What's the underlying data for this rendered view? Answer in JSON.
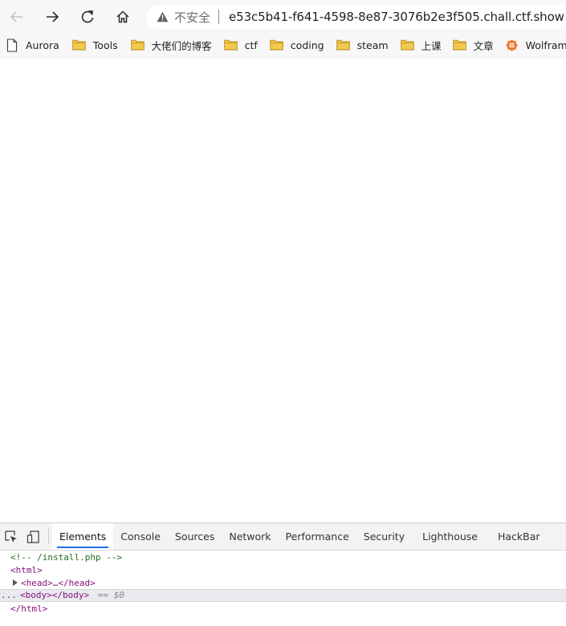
{
  "browser": {
    "security_label": "不安全",
    "url": "e53c5b41-f641-4598-8e87-3076b2e3f505.chall.ctf.show"
  },
  "bookmarks": [
    {
      "label": "Aurora",
      "icon": "page-icon"
    },
    {
      "label": "Tools",
      "icon": "folder-icon"
    },
    {
      "label": "大佬们的博客",
      "icon": "folder-icon"
    },
    {
      "label": "ctf",
      "icon": "folder-icon"
    },
    {
      "label": "coding",
      "icon": "folder-icon"
    },
    {
      "label": "steam",
      "icon": "folder-icon"
    },
    {
      "label": "上课",
      "icon": "folder-icon"
    },
    {
      "label": "文章",
      "icon": "folder-icon"
    },
    {
      "label": "Wolfram|Alpha",
      "icon": "wolfram-icon"
    }
  ],
  "devtools": {
    "tabs": [
      "Elements",
      "Console",
      "Sources",
      "Network",
      "Performance",
      "Security",
      "Lighthouse",
      "HackBar"
    ],
    "active_tab": "Elements",
    "code": {
      "comment": "<!-- /install.php -->",
      "html_open": "<html>",
      "head": "<head>…</head>",
      "head_open": "<head>",
      "head_ellipsis": "…",
      "head_close": "</head>",
      "body_open": "<body>",
      "body_close": "</body>",
      "selected_marker": "== $0",
      "html_close": "</html>",
      "dots": "..."
    }
  },
  "colors": {
    "accent": "#1a73e8",
    "folder": "#f2c94c",
    "comment": "#236e25",
    "tag": "#881280"
  }
}
